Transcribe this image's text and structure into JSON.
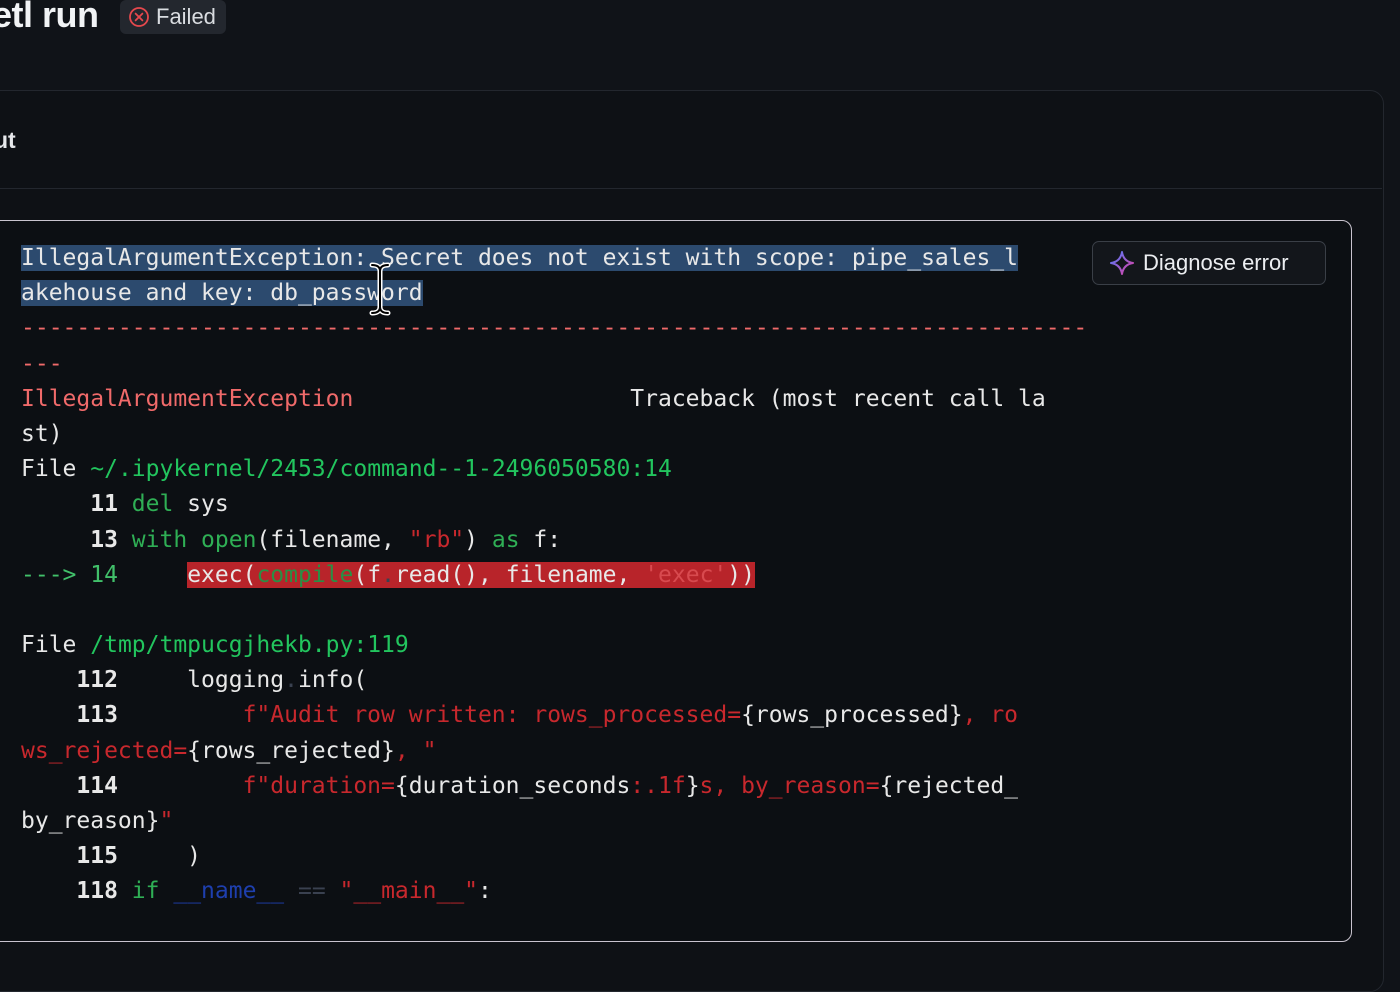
{
  "header": {
    "title": "etl run",
    "status": "Failed"
  },
  "section": {
    "label": "ut"
  },
  "diagnose_button": {
    "label": "Diagnose error"
  },
  "code_lines": [
    "IllegalArgumentException: Secret does not exist with scope: pipe_sales_l",
    "akehouse and key: db_password",
    "-----------------------------------------------------------------------------",
    "---",
    "IllegalArgumentException                    Traceback (most recent call la",
    "st)",
    "File ~/.ipykernel/2453/command--1-2496050580:14",
    "     11 del sys",
    "     13 with open(filename, \"rb\") as f:",
    "---> 14     exec(compile(f.read(), filename, 'exec'))",
    "",
    "File /tmp/tmpucgjhekb.py:119",
    "    112     logging.info(",
    "    113         f\"Audit row written: rows_processed={rows_processed}, ro",
    "ws_rejected={rows_rejected}, \"",
    "    114         f\"duration={duration_seconds:.1f}s, by_reason={rejected_",
    "by_reason}\"",
    "    115     )",
    "    118 if __name__ == \"__main__\":"
  ],
  "colors": {
    "background": "#101318",
    "selection": "#2c4a6e",
    "error_red": "#f06a6a",
    "path_green": "#22c55e",
    "highlight_red": "#b8242a",
    "badge_icon": "#e5484d",
    "sparkle_gradient": [
      "#4f7cff",
      "#e040a0"
    ]
  }
}
